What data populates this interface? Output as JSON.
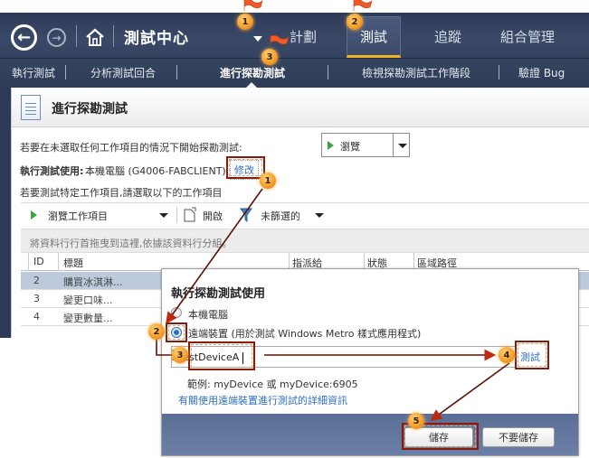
{
  "app": {
    "title": "測試中心",
    "top_tabs": [
      {
        "label": "計劃",
        "active": false
      },
      {
        "label": "測試",
        "active": true
      },
      {
        "label": "追蹤",
        "active": false
      },
      {
        "label": "組合管理",
        "active": false
      }
    ],
    "sub_tabs": [
      {
        "label": "執行測試",
        "active": false
      },
      {
        "label": "分析測試回合",
        "active": false
      },
      {
        "label": "進行探勘測試",
        "active": true
      },
      {
        "label": "檢視探勘測試工作階段",
        "active": false
      },
      {
        "label": "驗證 Bug",
        "active": false
      }
    ],
    "accent_color": "#f0b323"
  },
  "panel": {
    "title": "進行探勘測試",
    "intro": "若要在未選取任何工作項目的情況下開始探勘測試:",
    "run_with_label": "執行測試使用:",
    "run_with_value": "本機電腦 (G4006-FABCLIENT)",
    "modify_link": "修改",
    "specific_hint": "若要測試特定工作項目,請選取以下的工作項目",
    "browse_button": "瀏覽",
    "toolbar": {
      "browse_items": "瀏覽工作項目",
      "open": "開啟",
      "filter": "未篩選的"
    },
    "group_hint": "將資料行行首拖曳到這裡,依據該資料行分組。",
    "columns": [
      "ID",
      "標題",
      "指派給",
      "狀態",
      "區域路徑"
    ],
    "rows": [
      {
        "id": "2",
        "title": "購買冰淇淋...",
        "selected": true
      },
      {
        "id": "3",
        "title": "變更口味...",
        "selected": false
      },
      {
        "id": "4",
        "title": "變更數量...",
        "selected": false
      }
    ]
  },
  "dialog": {
    "title": "執行探勘測試使用",
    "option_local": "本機電腦",
    "option_remote": "遠端裝置 (用於測試 Windows Metro 樣式應用程式)",
    "selected_option": "remote",
    "device_value": "testDeviceA",
    "test_link": "測試",
    "example": "範例: myDevice 或 myDevice:6905",
    "more_info_link": "有關使用遠端裝置進行測試的詳細資訊",
    "save_button": "儲存",
    "dont_save_button": "不要儲存"
  },
  "annotations": {
    "top": [
      "1",
      "2",
      "3"
    ],
    "steps": [
      "1",
      "2",
      "3",
      "4",
      "5"
    ]
  }
}
